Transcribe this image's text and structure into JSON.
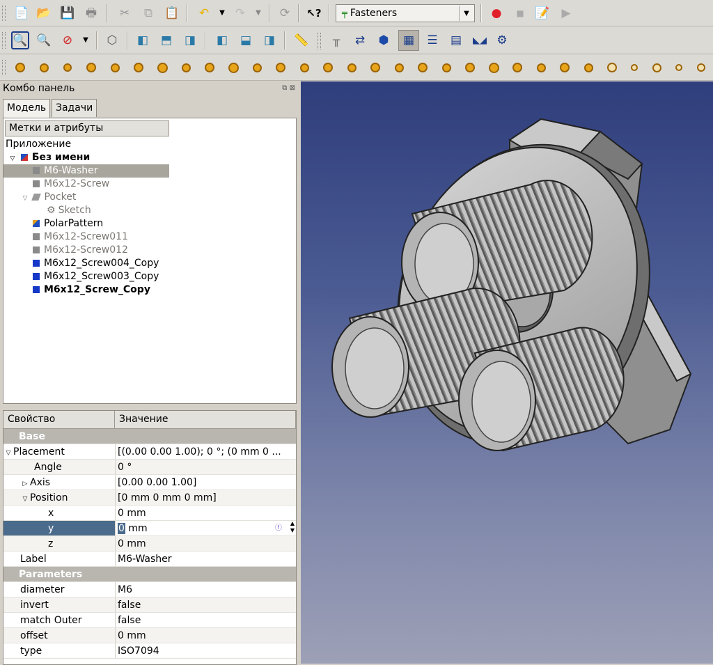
{
  "toolbar": {
    "workbench": "Fasteners"
  },
  "combo": {
    "title": "Комбо панель",
    "tabs": [
      "Модель",
      "Задачи"
    ],
    "tree_header": "Метки и атрибуты",
    "app_label": "Приложение",
    "doc_label": "Без имени",
    "items": [
      {
        "label": "M6-Washer",
        "state": "selected"
      },
      {
        "label": "M6x12-Screw",
        "state": "hidden"
      },
      {
        "label": "Pocket",
        "state": "hidden"
      },
      {
        "label": "Sketch",
        "state": "hidden"
      },
      {
        "label": "PolarPattern",
        "state": "normal"
      },
      {
        "label": "M6x12-Screw011",
        "state": "hidden"
      },
      {
        "label": "M6x12-Screw012",
        "state": "hidden"
      },
      {
        "label": "M6x12_Screw004_Copy",
        "state": "normal"
      },
      {
        "label": "M6x12_Screw003_Copy",
        "state": "normal"
      },
      {
        "label": "M6x12_Screw_Copy",
        "state": "bold"
      }
    ]
  },
  "props": {
    "col_property": "Свойство",
    "col_value": "Значение",
    "groups": {
      "base": "Base",
      "parameters": "Parameters"
    },
    "rows": {
      "placement": {
        "name": "Placement",
        "value": "[(0.00 0.00 1.00); 0 °; (0 mm  0 ..."
      },
      "angle": {
        "name": "Angle",
        "value": "0 °"
      },
      "axis": {
        "name": "Axis",
        "value": "[0.00 0.00 1.00]"
      },
      "position": {
        "name": "Position",
        "value": "[0 mm  0 mm  0 mm]"
      },
      "x": {
        "name": "x",
        "value": "0 mm"
      },
      "y": {
        "name": "y",
        "value_num": "0",
        "value_unit": "mm"
      },
      "z": {
        "name": "z",
        "value": "0 mm"
      },
      "label": {
        "name": "Label",
        "value": "M6-Washer"
      },
      "diameter": {
        "name": "diameter",
        "value": "M6"
      },
      "invert": {
        "name": "invert",
        "value": "false"
      },
      "match_outer": {
        "name": "match Outer",
        "value": "false"
      },
      "offset": {
        "name": "offset",
        "value": "0 mm"
      },
      "type": {
        "name": "type",
        "value": "ISO7094"
      }
    }
  },
  "colors": {
    "fastener_gold": "#e8a51a",
    "selection_gray": "#a8a59d",
    "edit_row": "#4b6b8c",
    "viewport_top": "#2f3e7c",
    "viewport_bottom": "#9da0b6",
    "part_gray": "#c7c7c7"
  }
}
